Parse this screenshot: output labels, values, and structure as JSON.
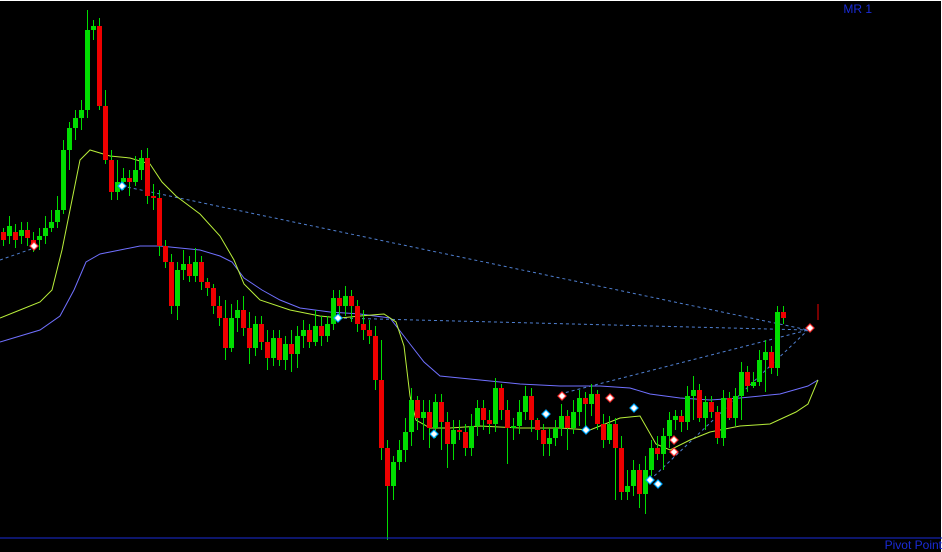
{
  "labels": {
    "top_right": "MR 1",
    "bottom_right": "Pivot Point"
  },
  "colors": {
    "background": "#000000",
    "bull": "#00dd00",
    "bear": "#ee0000",
    "wick": "#00dd00",
    "ma_fast": "#b8ee3a",
    "ma_slow": "#7070ff",
    "trendline": "#4f7fd0",
    "pivot_line": "#1a2bd6",
    "frame": "#ffffff",
    "marker_fill": "#ffffff",
    "marker_buy_edge": "#00aaff",
    "marker_sell_edge": "#ff3333"
  },
  "chart_data": {
    "type": "candlestick",
    "ylim": [
      0,
      552
    ],
    "y_axis_inverted": true,
    "x_step": 6,
    "x_start": 3,
    "candles": [
      [
        232,
        240,
        228,
        246
      ],
      [
        236,
        226,
        216,
        244
      ],
      [
        232,
        240,
        224,
        248
      ],
      [
        236,
        230,
        222,
        244
      ],
      [
        230,
        238,
        222,
        246
      ],
      [
        240,
        244,
        232,
        252
      ],
      [
        240,
        236,
        228,
        250
      ],
      [
        236,
        228,
        216,
        244
      ],
      [
        228,
        222,
        210,
        232
      ],
      [
        222,
        210,
        196,
        228
      ],
      [
        210,
        150,
        140,
        214
      ],
      [
        150,
        128,
        122,
        170
      ],
      [
        128,
        118,
        110,
        140
      ],
      [
        118,
        110,
        100,
        130
      ],
      [
        110,
        30,
        10,
        118
      ],
      [
        30,
        26,
        20,
        40
      ],
      [
        26,
        106,
        18,
        110
      ],
      [
        106,
        160,
        90,
        164
      ],
      [
        160,
        192,
        150,
        200
      ],
      [
        192,
        182,
        160,
        200
      ],
      [
        182,
        178,
        168,
        190
      ],
      [
        178,
        182,
        170,
        196
      ],
      [
        182,
        170,
        156,
        186
      ],
      [
        170,
        158,
        150,
        180
      ],
      [
        158,
        196,
        148,
        204
      ],
      [
        196,
        198,
        184,
        210
      ],
      [
        198,
        246,
        190,
        256
      ],
      [
        246,
        262,
        240,
        268
      ],
      [
        262,
        306,
        254,
        314
      ],
      [
        306,
        270,
        262,
        320
      ],
      [
        270,
        264,
        250,
        280
      ],
      [
        264,
        276,
        256,
        282
      ],
      [
        276,
        262,
        248,
        282
      ],
      [
        262,
        282,
        256,
        290
      ],
      [
        282,
        288,
        278,
        296
      ],
      [
        288,
        306,
        284,
        314
      ],
      [
        306,
        318,
        296,
        326
      ],
      [
        318,
        348,
        300,
        360
      ],
      [
        348,
        318,
        304,
        352
      ],
      [
        318,
        310,
        300,
        332
      ],
      [
        310,
        328,
        296,
        336
      ],
      [
        328,
        348,
        312,
        364
      ],
      [
        348,
        324,
        316,
        356
      ],
      [
        324,
        342,
        316,
        350
      ],
      [
        342,
        358,
        330,
        370
      ],
      [
        358,
        338,
        330,
        366
      ],
      [
        338,
        360,
        330,
        366
      ],
      [
        360,
        344,
        336,
        370
      ],
      [
        344,
        354,
        330,
        372
      ],
      [
        354,
        336,
        326,
        368
      ],
      [
        336,
        330,
        320,
        348
      ],
      [
        330,
        342,
        324,
        348
      ],
      [
        342,
        326,
        310,
        346
      ],
      [
        326,
        336,
        316,
        346
      ],
      [
        336,
        324,
        316,
        342
      ],
      [
        324,
        298,
        290,
        330
      ],
      [
        298,
        306,
        290,
        320
      ],
      [
        306,
        296,
        286,
        316
      ],
      [
        296,
        306,
        290,
        322
      ],
      [
        306,
        324,
        300,
        332
      ],
      [
        324,
        330,
        310,
        340
      ],
      [
        330,
        336,
        320,
        344
      ],
      [
        336,
        380,
        326,
        390
      ],
      [
        380,
        448,
        340,
        460
      ],
      [
        448,
        486,
        440,
        540
      ],
      [
        486,
        462,
        456,
        500
      ],
      [
        462,
        450,
        440,
        470
      ],
      [
        450,
        432,
        418,
        462
      ],
      [
        432,
        400,
        388,
        446
      ],
      [
        400,
        418,
        396,
        430
      ],
      [
        418,
        412,
        400,
        440
      ],
      [
        412,
        428,
        400,
        448
      ],
      [
        428,
        402,
        394,
        438
      ],
      [
        402,
        422,
        394,
        450
      ],
      [
        422,
        444,
        412,
        468
      ],
      [
        444,
        430,
        420,
        460
      ],
      [
        430,
        432,
        420,
        440
      ],
      [
        432,
        448,
        424,
        456
      ],
      [
        448,
        426,
        414,
        456
      ],
      [
        426,
        408,
        400,
        436
      ],
      [
        408,
        420,
        400,
        430
      ],
      [
        420,
        424,
        410,
        434
      ],
      [
        424,
        388,
        378,
        432
      ],
      [
        388,
        410,
        384,
        420
      ],
      [
        410,
        428,
        400,
        464
      ],
      [
        428,
        426,
        418,
        440
      ],
      [
        426,
        412,
        400,
        434
      ],
      [
        412,
        396,
        386,
        420
      ],
      [
        396,
        420,
        388,
        432
      ],
      [
        420,
        430,
        418,
        440
      ],
      [
        430,
        444,
        424,
        456
      ],
      [
        444,
        438,
        428,
        456
      ],
      [
        438,
        428,
        420,
        446
      ],
      [
        428,
        416,
        404,
        436
      ],
      [
        416,
        428,
        410,
        450
      ],
      [
        428,
        412,
        400,
        434
      ],
      [
        412,
        398,
        390,
        426
      ],
      [
        398,
        404,
        392,
        430
      ],
      [
        404,
        394,
        384,
        416
      ],
      [
        394,
        424,
        390,
        430
      ],
      [
        424,
        440,
        414,
        448
      ],
      [
        440,
        424,
        416,
        444
      ],
      [
        424,
        448,
        418,
        500
      ],
      [
        448,
        492,
        436,
        500
      ],
      [
        492,
        486,
        470,
        500
      ],
      [
        486,
        470,
        460,
        496
      ],
      [
        470,
        494,
        464,
        508
      ],
      [
        494,
        470,
        456,
        514
      ],
      [
        470,
        448,
        440,
        476
      ],
      [
        448,
        454,
        436,
        460
      ],
      [
        454,
        436,
        428,
        470
      ],
      [
        436,
        420,
        412,
        448
      ],
      [
        420,
        416,
        410,
        430
      ],
      [
        416,
        422,
        410,
        432
      ],
      [
        422,
        396,
        386,
        430
      ],
      [
        396,
        390,
        376,
        420
      ],
      [
        390,
        418,
        384,
        422
      ],
      [
        418,
        402,
        396,
        430
      ],
      [
        402,
        412,
        396,
        418
      ],
      [
        412,
        438,
        406,
        444
      ],
      [
        438,
        398,
        390,
        446
      ],
      [
        398,
        418,
        392,
        420
      ],
      [
        418,
        396,
        388,
        426
      ],
      [
        396,
        372,
        362,
        420
      ],
      [
        372,
        386,
        366,
        392
      ],
      [
        386,
        382,
        372,
        388
      ],
      [
        382,
        360,
        350,
        386
      ],
      [
        360,
        352,
        340,
        392
      ],
      [
        352,
        368,
        346,
        374
      ],
      [
        368,
        312,
        306,
        376
      ],
      [
        312,
        318,
        306,
        324
      ]
    ],
    "ma_fast": [
      [
        0,
        318
      ],
      [
        20,
        310
      ],
      [
        40,
        302
      ],
      [
        52,
        290
      ],
      [
        62,
        250
      ],
      [
        72,
        200
      ],
      [
        80,
        160
      ],
      [
        90,
        150
      ],
      [
        110,
        156
      ],
      [
        130,
        158
      ],
      [
        150,
        164
      ],
      [
        162,
        182
      ],
      [
        176,
        196
      ],
      [
        200,
        214
      ],
      [
        220,
        236
      ],
      [
        234,
        260
      ],
      [
        244,
        284
      ],
      [
        260,
        300
      ],
      [
        290,
        310
      ],
      [
        320,
        316
      ],
      [
        340,
        318
      ],
      [
        360,
        316
      ],
      [
        384,
        314
      ],
      [
        396,
        322
      ],
      [
        404,
        346
      ],
      [
        410,
        396
      ],
      [
        416,
        420
      ],
      [
        430,
        428
      ],
      [
        450,
        428
      ],
      [
        480,
        426
      ],
      [
        520,
        428
      ],
      [
        560,
        428
      ],
      [
        590,
        430
      ],
      [
        620,
        418
      ],
      [
        640,
        416
      ],
      [
        656,
        444
      ],
      [
        670,
        450
      ],
      [
        690,
        440
      ],
      [
        710,
        432
      ],
      [
        740,
        426
      ],
      [
        770,
        424
      ],
      [
        796,
        412
      ],
      [
        808,
        404
      ],
      [
        818,
        380
      ]
    ],
    "ma_slow": [
      [
        0,
        342
      ],
      [
        20,
        336
      ],
      [
        40,
        330
      ],
      [
        60,
        316
      ],
      [
        74,
        290
      ],
      [
        86,
        262
      ],
      [
        100,
        254
      ],
      [
        120,
        250
      ],
      [
        140,
        246
      ],
      [
        160,
        246
      ],
      [
        180,
        248
      ],
      [
        200,
        250
      ],
      [
        220,
        256
      ],
      [
        232,
        262
      ],
      [
        244,
        278
      ],
      [
        262,
        290
      ],
      [
        280,
        300
      ],
      [
        300,
        308
      ],
      [
        330,
        312
      ],
      [
        360,
        314
      ],
      [
        390,
        318
      ],
      [
        410,
        344
      ],
      [
        424,
        362
      ],
      [
        440,
        376
      ],
      [
        480,
        380
      ],
      [
        520,
        384
      ],
      [
        560,
        386
      ],
      [
        600,
        386
      ],
      [
        630,
        388
      ],
      [
        650,
        394
      ],
      [
        680,
        398
      ],
      [
        710,
        400
      ],
      [
        740,
        398
      ],
      [
        780,
        394
      ],
      [
        808,
        386
      ],
      [
        818,
        380
      ]
    ],
    "trendlines": [
      [
        122,
        186,
        808,
        330
      ],
      [
        338,
        318,
        808,
        330
      ],
      [
        560,
        394,
        808,
        330
      ],
      [
        650,
        480,
        808,
        330
      ],
      [
        0,
        260,
        40,
        246
      ]
    ],
    "markers": [
      {
        "x": 34,
        "y": 246,
        "kind": "sell"
      },
      {
        "x": 122,
        "y": 186,
        "kind": "buy"
      },
      {
        "x": 338,
        "y": 318,
        "kind": "buy"
      },
      {
        "x": 434,
        "y": 434,
        "kind": "buy"
      },
      {
        "x": 546,
        "y": 414,
        "kind": "buy"
      },
      {
        "x": 562,
        "y": 396,
        "kind": "sell"
      },
      {
        "x": 586,
        "y": 430,
        "kind": "buy"
      },
      {
        "x": 610,
        "y": 398,
        "kind": "sell"
      },
      {
        "x": 634,
        "y": 408,
        "kind": "buy"
      },
      {
        "x": 650,
        "y": 480,
        "kind": "buy"
      },
      {
        "x": 658,
        "y": 484,
        "kind": "buy"
      },
      {
        "x": 674,
        "y": 440,
        "kind": "sell"
      },
      {
        "x": 674,
        "y": 452,
        "kind": "sell"
      },
      {
        "x": 810,
        "y": 328,
        "kind": "sell"
      }
    ],
    "pivot_y": 538,
    "last_tick": {
      "x": 818,
      "y": 310
    }
  }
}
